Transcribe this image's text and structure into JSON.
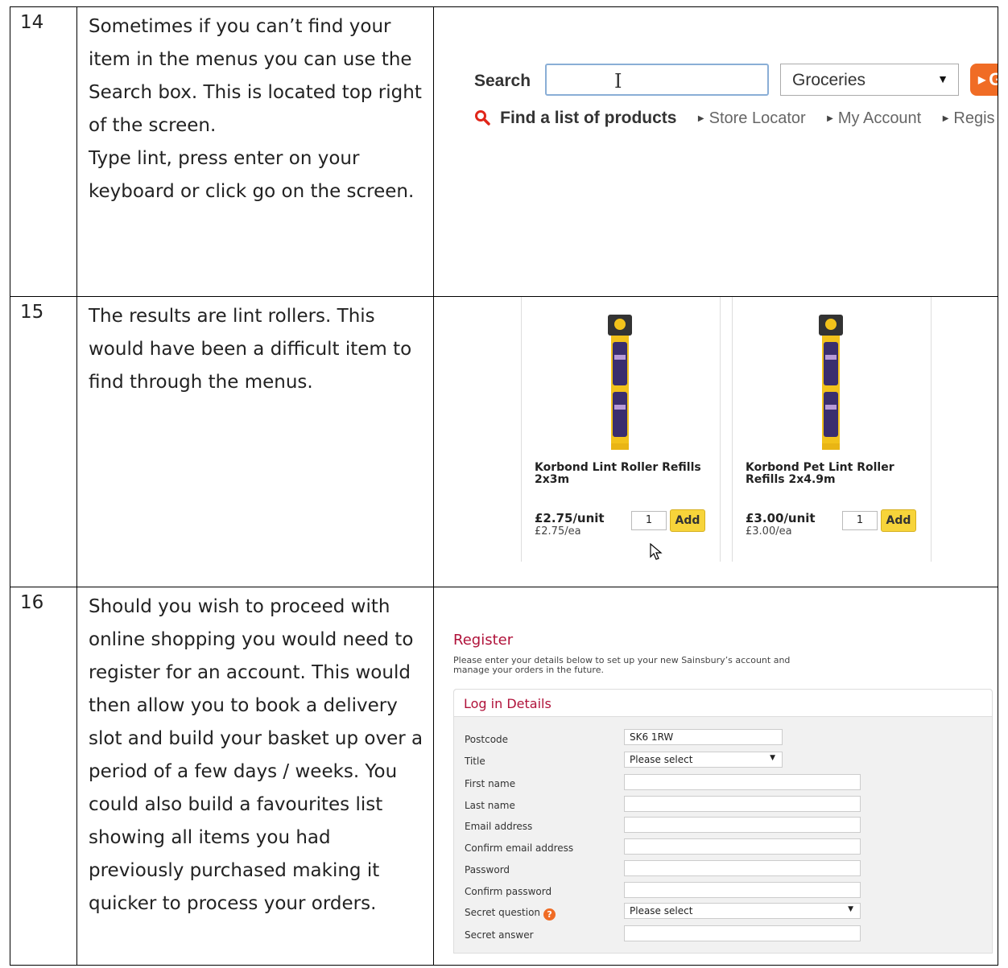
{
  "rows": [
    {
      "num": "14",
      "text": "Sometimes if you can’t find your item in the menus you can use the Search box.  This is located top right of the screen.\nType lint, press enter on your keyboard or click go on the screen."
    },
    {
      "num": "15",
      "text": "The results are lint rollers. This would have been a difficult item to find through the menus."
    },
    {
      "num": "16",
      "text": "Should you wish to proceed with online shopping you would need to register for an account. This would then allow you to book a delivery slot and build your basket up over a period of a few days / weeks. You could also build a favourites list showing all items you had previously purchased making it quicker to process your orders."
    }
  ],
  "search": {
    "label": "Search",
    "category": "Groceries",
    "go_label": "Go",
    "find_list": "Find a list of products",
    "links": [
      "Store Locator",
      "My Account",
      "Regis"
    ]
  },
  "products": [
    {
      "name": "Korbond Lint Roller Refills 2x3m",
      "price": "£2.75/unit",
      "each": "£2.75/ea",
      "qty": "1",
      "add": "Add"
    },
    {
      "name": "Korbond Pet Lint Roller Refills 2x4.9m",
      "price": "£3.00/unit",
      "each": "£3.00/ea",
      "qty": "1",
      "add": "Add"
    }
  ],
  "register": {
    "title": "Register",
    "description": "Please enter your details below to set up your new Sainsbury’s account and manage your orders in the future.",
    "section": "Log in Details",
    "fields": [
      {
        "label": "Postcode",
        "value": "SK6 1RW"
      },
      {
        "label": "Title",
        "value": "Please select"
      },
      {
        "label": "First name",
        "value": ""
      },
      {
        "label": "Last name",
        "value": ""
      },
      {
        "label": "Email address",
        "value": ""
      },
      {
        "label": "Confirm email address",
        "value": ""
      },
      {
        "label": "Password",
        "value": ""
      },
      {
        "label": "Confirm password",
        "value": ""
      },
      {
        "label": "Secret question",
        "value": "Please select"
      },
      {
        "label": "Secret answer",
        "value": ""
      }
    ]
  },
  "colors": {
    "go_orange": "#f06c25",
    "brand_red": "#b0123a",
    "add_yellow": "#f7d43a",
    "search_icon_red": "#e0261a"
  }
}
